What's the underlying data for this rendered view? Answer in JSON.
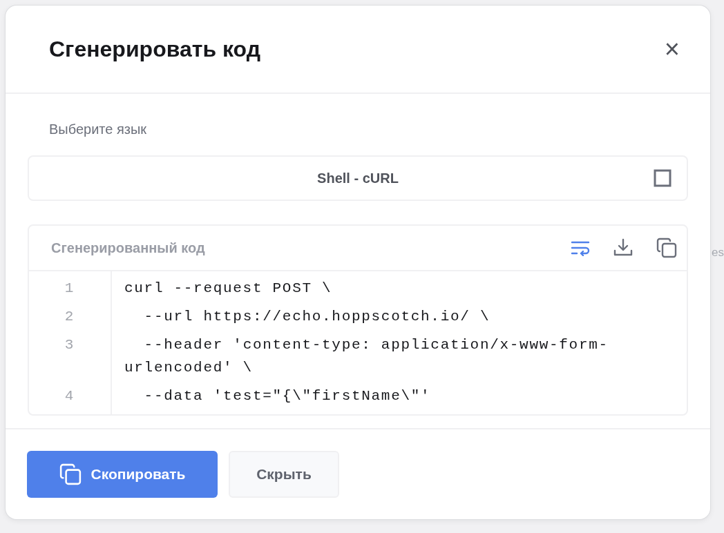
{
  "background": {
    "fragment": "es"
  },
  "dialog": {
    "title": "Сгенерировать код",
    "close": "×"
  },
  "language": {
    "label": "Выберите язык",
    "value": "Shell - cURL"
  },
  "code_panel": {
    "title": "Сгенерированный код",
    "wrap_on": true,
    "lines": [
      {
        "number": "1",
        "text": "curl --request POST \\"
      },
      {
        "number": "2",
        "text": "  --url https://echo.hoppscotch.io/ \\"
      },
      {
        "number": "3",
        "text": "  --header 'content-type: application/x-www-form-urlencoded' \\"
      },
      {
        "number": "4",
        "text": "  --data 'test=\"{\\\"firstName\\\"'"
      }
    ]
  },
  "buttons": [
    {
      "label": "Скопировать",
      "kind": "primary"
    },
    {
      "label": "Скрыть",
      "kind": "secondary"
    }
  ]
}
